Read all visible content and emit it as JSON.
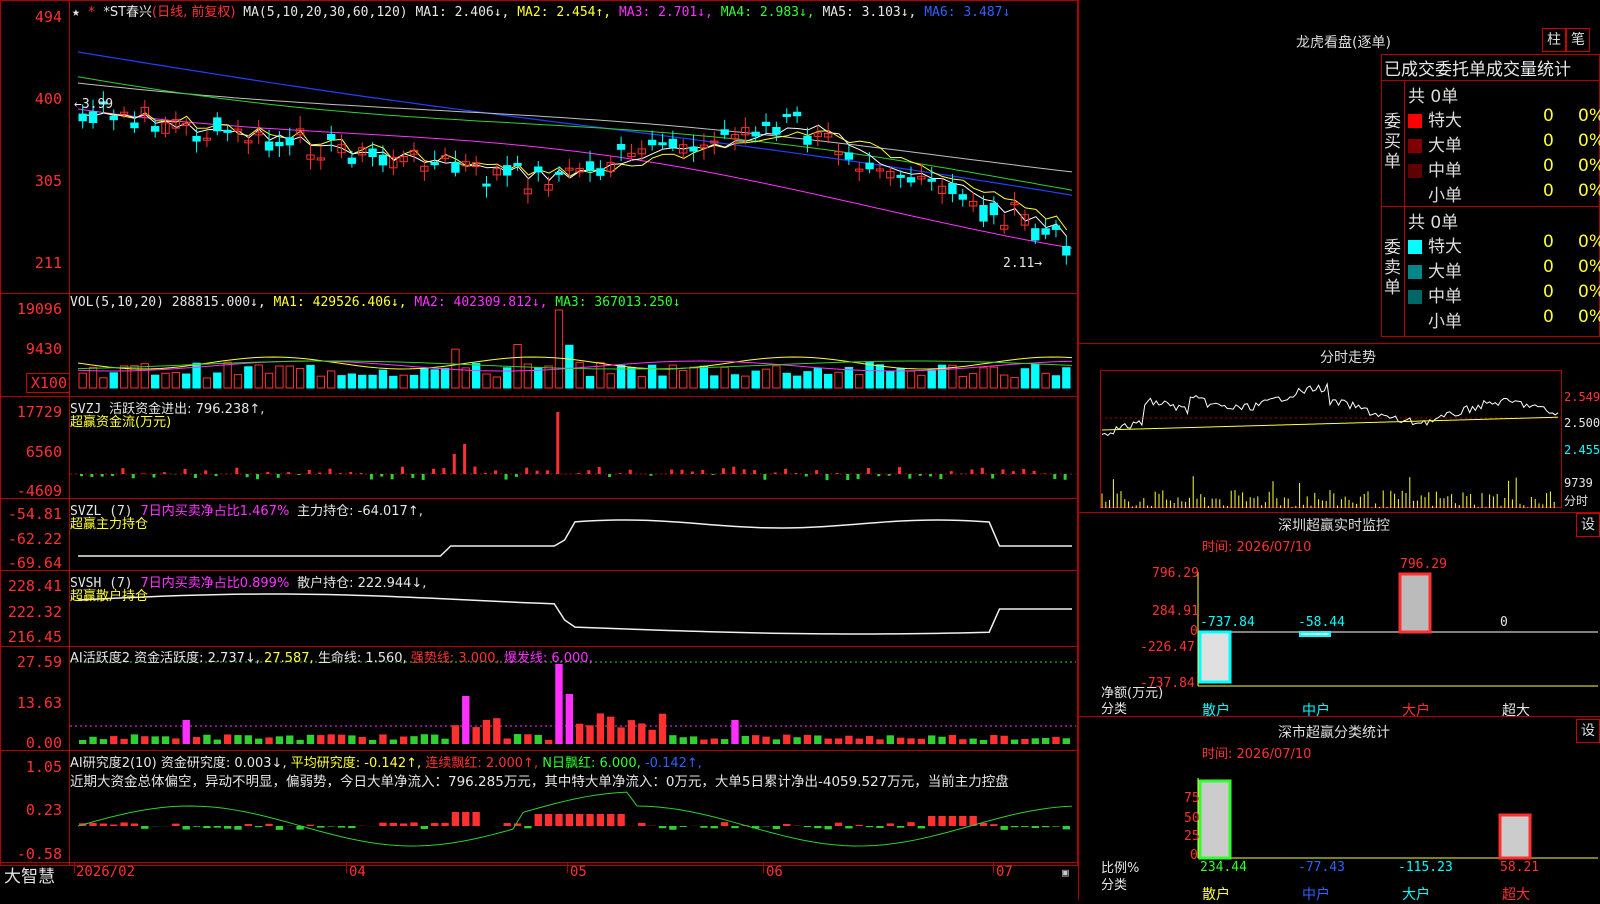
{
  "colors": {
    "up": "#ff3030",
    "down": "#00ffff",
    "ma1": "#ffffff",
    "ma2": "#ffff30",
    "ma3": "#ff30ff",
    "ma4": "#30d030",
    "ma5": "#c0c0c0",
    "ma6": "#2040ff",
    "grid": "#b00000"
  },
  "kline": {
    "title_star": "★",
    "title_name": "*ST春兴",
    "title_mode": "(日线, 前复权)",
    "ma_label": "MA(5,10,20,30,60,120)",
    "ma1": "MA1: 2.406↓,",
    "ma2": "MA2: 2.454↑,",
    "ma3": "MA3: 2.701↓,",
    "ma4": "MA4: 2.983↓,",
    "ma5": "MA5: 3.103↓,",
    "ma6": "MA6: 3.487↓",
    "y_labels": [
      "494",
      "400",
      "305",
      "211"
    ],
    "high_mark": "←3.99",
    "low_mark": "2.11→"
  },
  "vol": {
    "title": "VOL(5,10,20)",
    "v": "288815.000↓,",
    "ma1": "MA1: 429526.406↓,",
    "ma2": "MA2: 402309.812↓,",
    "ma3": "MA3: 367013.250↓",
    "y_labels": [
      "19096",
      "9430",
      "X100"
    ]
  },
  "svzj": {
    "line1_name": "SVZJ",
    "line1_text": "活跃资金进出: 796.238↑,",
    "line2_text": "超赢资金流(万元)",
    "y_labels": [
      "17729",
      "6560",
      "-4609"
    ]
  },
  "svzl": {
    "name": "SVZL (7)",
    "ratio": "7日内买卖净占比1.467%",
    "hold": "主力持仓: -64.017↑,",
    "line2": "超赢主力持仓",
    "y_labels": [
      "-54.81",
      "-62.22",
      "-69.64"
    ]
  },
  "svsh": {
    "name": "SVSH (7)",
    "ratio": "7日内买卖净占比0.899%",
    "hold": "散户持仓: 222.944↓,",
    "line2": "超赢散户持仓",
    "y_labels": [
      "228.41",
      "222.32",
      "216.45"
    ]
  },
  "ai1": {
    "name": "AI活跃度2",
    "a": "资金活跃度: 2.737↓,",
    "b": "27.587,",
    "c": "生命线: 1.560,",
    "d": "强势线: 3.000,",
    "e": "爆发线: 6.000,",
    "y_labels": [
      "27.59",
      "13.63",
      "0.00"
    ]
  },
  "ai2": {
    "name": "AI研究度2(10)",
    "a": "资金研究度: 0.003↓,",
    "b": "平均研究度: -0.142↑,",
    "c": "连续飘红: 2.000↑,",
    "d": "N日飘红: 6.000,",
    "e": "-0.142↑,",
    "text": "近期大资金总体偏空，异动不明显，偏弱势，今日大单净流入：796.285万元，其中特大单净流入：0万元，大单5日累计净出-4059.527万元，当前主力控盘",
    "y_labels": [
      "1.05",
      "0.23",
      "-0.58"
    ]
  },
  "xaxis": {
    "brand": "大智慧",
    "labels": [
      "2026/02",
      "04",
      "05",
      "06",
      "07"
    ]
  },
  "dragon": {
    "title": "龙虎看盘(逐单)",
    "btn1": "柱",
    "btn2": "笔",
    "header": "已成交委托单成交量统计",
    "buy_label": "委买单",
    "sell_label": "委卖单",
    "buy_total": "共 0单",
    "sell_total": "共 0单",
    "buy_rows": [
      {
        "name": "特大",
        "count": "0",
        "pct": "0%",
        "color": "#ff0000"
      },
      {
        "name": "大单",
        "count": "0",
        "pct": "0%",
        "color": "#800000"
      },
      {
        "name": "中单",
        "count": "0",
        "pct": "0%",
        "color": "#600000"
      },
      {
        "name": "小单",
        "count": "0",
        "pct": "0%",
        "color": ""
      }
    ],
    "sell_rows": [
      {
        "name": "特大",
        "count": "0",
        "pct": "0%",
        "color": "#00ffff"
      },
      {
        "name": "大单",
        "count": "0",
        "pct": "0%",
        "color": "#008888"
      },
      {
        "name": "中单",
        "count": "0",
        "pct": "0%",
        "color": "#006666"
      },
      {
        "name": "小单",
        "count": "0",
        "pct": "0%",
        "color": ""
      }
    ]
  },
  "fenshi": {
    "title": "分时走势",
    "y_labels": [
      "2.549",
      "2.500",
      "2.455"
    ],
    "vol_label": "9739",
    "unit": "分时"
  },
  "monitor": {
    "title": "深圳超赢实时监控",
    "btn": "设",
    "time": "时间: 2026/07/10",
    "y_labels": [
      "796.29",
      "284.91",
      "0",
      "-226.47",
      "-737.84"
    ],
    "axis_title": "净额(万元)",
    "axis_sub": "分类",
    "values": [
      "-737.84",
      "-58.44",
      "796.29",
      "0"
    ],
    "categories": [
      "散户",
      "中户",
      "大户",
      "超大"
    ]
  },
  "stats": {
    "title": "深市超赢分类统计",
    "btn": "设",
    "time": "时间: 2026/07/10",
    "y_labels": [
      "75",
      "50",
      "25",
      "0"
    ],
    "axis_title": "比例%",
    "axis_sub": "分类",
    "values": [
      "234.44",
      "-77.43",
      "-115.23",
      "58.21"
    ],
    "categories": [
      "散户",
      "中户",
      "大户",
      "超大"
    ]
  }
}
